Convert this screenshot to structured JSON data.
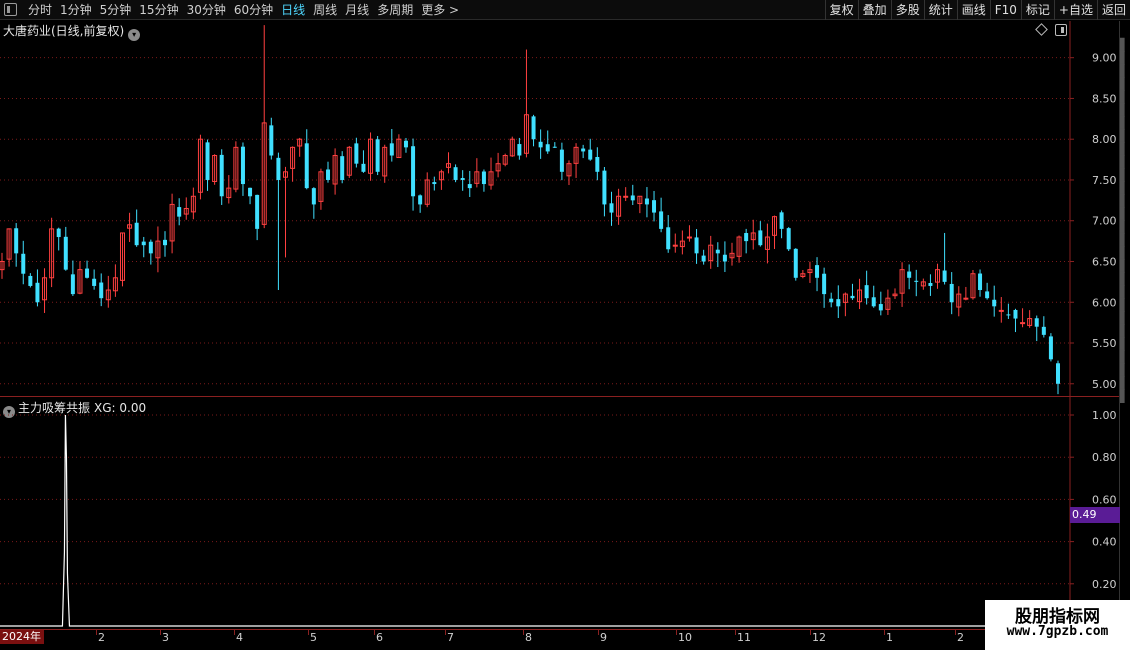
{
  "toolbar": {
    "period_tabs": [
      "分时",
      "1分钟",
      "5分钟",
      "15分钟",
      "30分钟",
      "60分钟",
      "日线",
      "周线",
      "月线",
      "多周期",
      "更多 >"
    ],
    "active_tab": "日线",
    "right_buttons": [
      "复权",
      "叠加",
      "多股",
      "统计",
      "画线",
      "F10",
      "标记",
      "+自选",
      "返回"
    ]
  },
  "main_chart": {
    "title": "大唐药业(日线,前复权)",
    "y_ticks": [
      "9.00",
      "8.50",
      "8.00",
      "7.50",
      "7.00",
      "6.50",
      "6.00",
      "5.50",
      "5.00"
    ]
  },
  "sub_chart": {
    "indicator_name": "主力吸筹共振",
    "xg_label": "XG: 0.00",
    "y_ticks": [
      "1.00",
      "0.80",
      "0.60",
      "0.40",
      "0.20"
    ],
    "current_value_marker": "0.49"
  },
  "date_axis": {
    "cursor_label": "2024年",
    "month_labels": [
      "2",
      "3",
      "4",
      "5",
      "6",
      "7",
      "8",
      "9",
      "10",
      "11",
      "12",
      "1",
      "2"
    ]
  },
  "watermark": {
    "title": "股朋指标网",
    "url": "www.7gpzb.com"
  },
  "colors": {
    "up": "#ff4040",
    "down": "#40e0ff",
    "grid": "#7a1a1a",
    "axis_line": "#8a2020",
    "indicator_line": "#ffffff",
    "marker_bg": "#5a1c96"
  },
  "chart_data": {
    "type": "candlestick",
    "ylim": [
      4.85,
      9.45
    ],
    "closes": [
      6.5,
      6.9,
      6.6,
      6.35,
      6.2,
      6.0,
      6.3,
      6.9,
      6.8,
      6.4,
      6.1,
      6.4,
      6.3,
      6.2,
      6.05,
      6.15,
      6.3,
      6.85,
      6.95,
      6.7,
      6.7,
      6.6,
      6.75,
      6.7,
      7.2,
      7.05,
      7.15,
      7.3,
      8.0,
      7.5,
      7.8,
      7.3,
      7.4,
      7.9,
      7.45,
      7.3,
      6.9,
      8.2,
      7.8,
      7.5,
      7.6,
      7.9,
      8.0,
      7.4,
      7.2,
      7.6,
      7.5,
      7.8,
      7.5,
      7.9,
      7.7,
      7.6,
      8.0,
      7.6,
      7.9,
      7.8,
      8.0,
      7.9,
      7.3,
      7.2,
      7.5,
      7.45,
      7.6,
      7.7,
      7.5,
      7.5,
      7.4,
      7.6,
      7.45,
      7.6,
      7.7,
      7.8,
      8.0,
      7.8,
      8.3,
      8.0,
      7.9,
      7.85,
      7.9,
      7.6,
      7.7,
      7.9,
      7.85,
      7.75,
      7.6,
      7.2,
      7.1,
      7.3,
      7.3,
      7.25,
      7.3,
      7.2,
      7.1,
      6.9,
      6.65,
      6.7,
      6.75,
      6.8,
      6.6,
      6.5,
      6.7,
      6.6,
      6.5,
      6.6,
      6.8,
      6.75,
      6.85,
      6.7,
      6.8,
      7.05,
      6.9,
      6.65,
      6.3,
      6.35,
      6.4,
      6.3,
      6.1,
      6.0,
      5.95,
      6.1,
      6.05,
      6.15,
      6.05,
      5.95,
      5.9,
      6.05,
      6.1,
      6.4,
      6.3,
      6.25,
      6.25,
      6.2,
      6.4,
      6.25,
      6.0,
      6.1,
      6.05,
      6.35,
      6.15,
      6.05,
      5.95,
      5.9,
      5.85,
      5.8,
      5.75,
      5.8,
      5.7,
      5.6,
      5.3,
      5.0
    ],
    "indicator": {
      "name": "主力吸筹共振",
      "ylim": [
        0,
        1.0
      ],
      "spike_index": 5,
      "spike_value": 1.0
    }
  }
}
